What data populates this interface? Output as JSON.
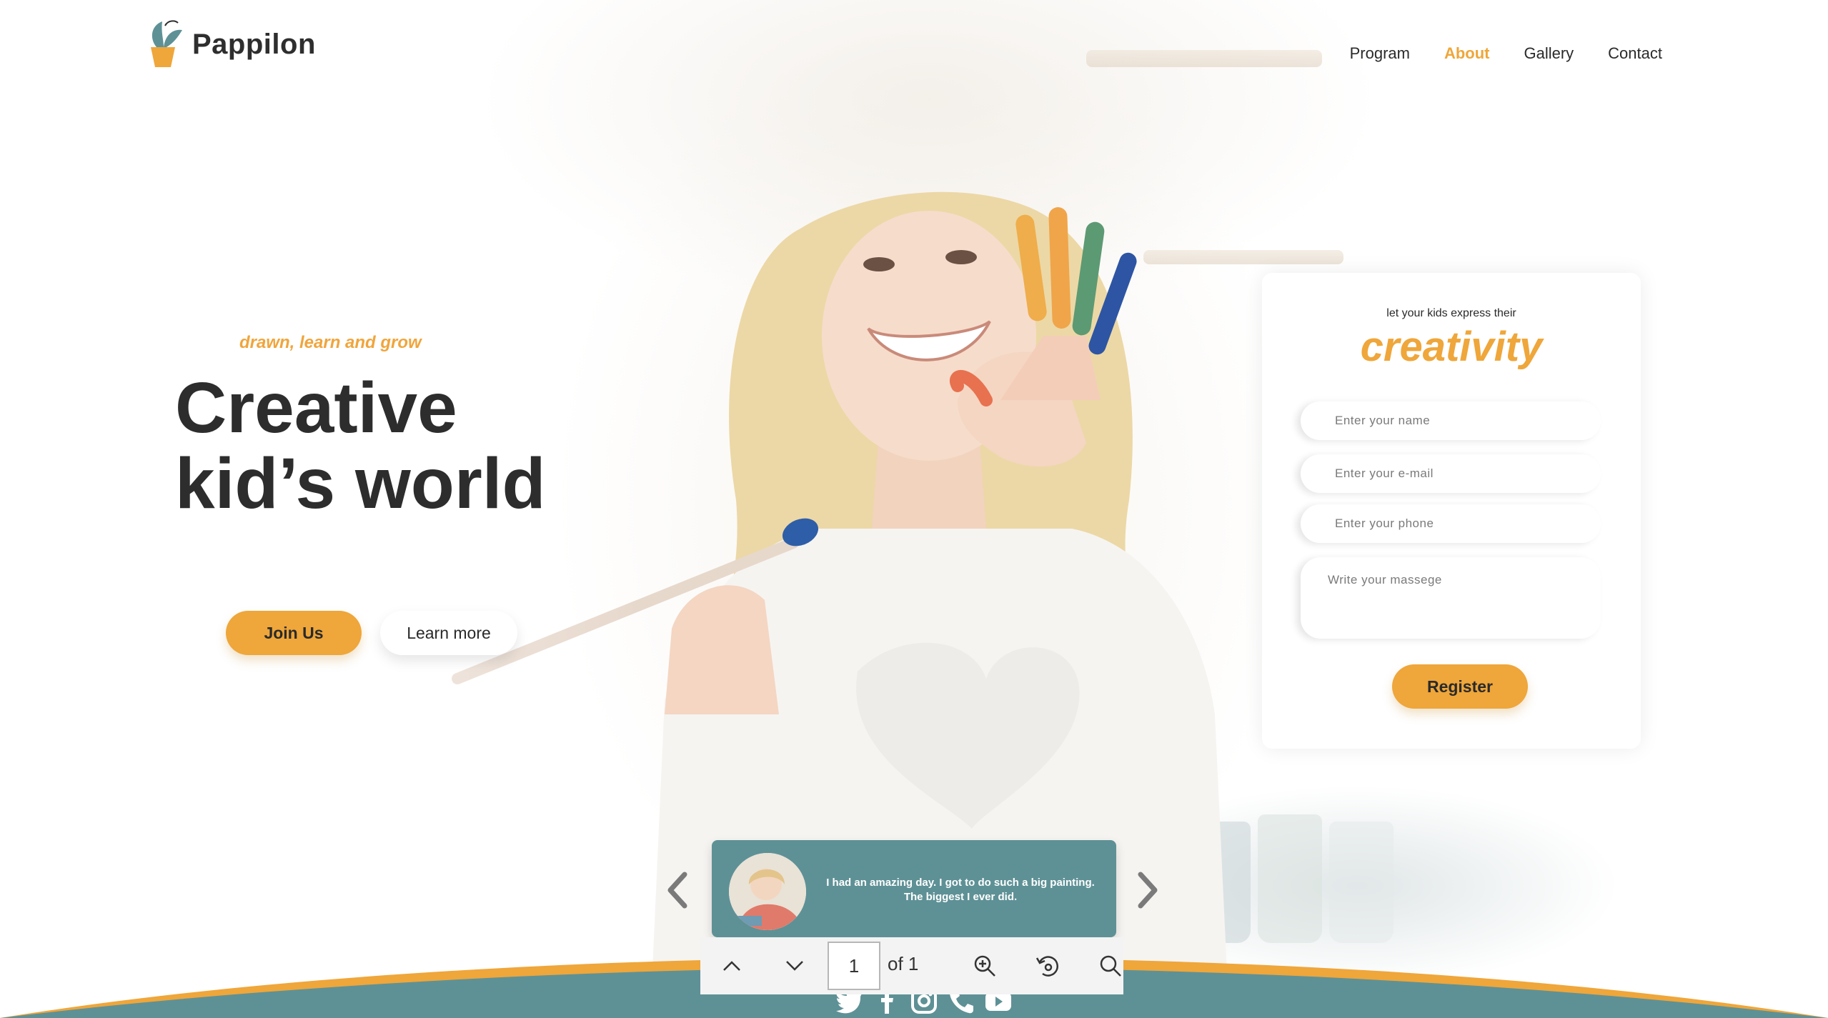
{
  "brand": {
    "name": "Pappilon",
    "colors": {
      "accent": "#efa63a",
      "teal": "#5e9196",
      "text": "#2b2b2b"
    }
  },
  "nav": {
    "items": [
      {
        "label": "Program",
        "active": false
      },
      {
        "label": "About",
        "active": true
      },
      {
        "label": "Gallery",
        "active": false
      },
      {
        "label": "Contact",
        "active": false
      }
    ]
  },
  "hero": {
    "tagline": "drawn, learn and grow",
    "title_line1": "Creative",
    "title_line2": "kid’s world",
    "join_label": "Join Us",
    "learn_label": "Learn more"
  },
  "form": {
    "subtitle": "let your kids express their",
    "headline": "creativity",
    "name_placeholder": "Enter your name",
    "email_placeholder": "Enter your e-mail",
    "phone_placeholder": "Enter your phone",
    "message_placeholder": "Write your massege",
    "register_label": "Register"
  },
  "testimonial": {
    "quote_line1": "I had an amazing day. I got to do such a big painting.",
    "quote_line2": "The biggest I ever did.",
    "prev_icon": "chevron-left-icon",
    "next_icon": "chevron-right-icon"
  },
  "pdf_toolbar": {
    "page": "1",
    "of_label": "of 1",
    "icons": [
      "chevron-up-icon",
      "chevron-down-icon",
      "zoom-in-icon",
      "rotate-icon",
      "search-icon"
    ]
  },
  "social": {
    "icons": [
      "twitter-icon",
      "facebook-icon",
      "instagram-icon",
      "phone-icon",
      "youtube-icon"
    ]
  }
}
